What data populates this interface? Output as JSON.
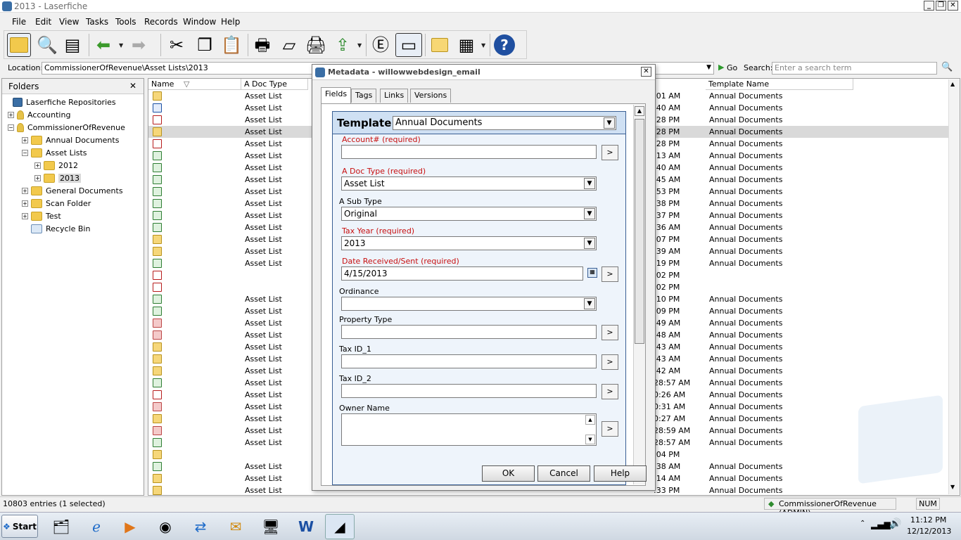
{
  "window": {
    "title": "2013 - Laserfiche",
    "min": "_",
    "restore": "❐",
    "close": "✕"
  },
  "menu": [
    "File",
    "Edit",
    "View",
    "Tasks",
    "Tools",
    "Records",
    "Window",
    "Help"
  ],
  "location": {
    "label": "Location:",
    "value": "CommissionerOfRevenue\\Asset Lists\\2013",
    "go": "Go",
    "search_label": "Search:",
    "search_placeholder": "Enter a search term"
  },
  "folders": {
    "title": "Folders",
    "close": "✕",
    "items": [
      {
        "label": "Laserfiche Repositories",
        "expand": ""
      },
      {
        "label": "Accounting",
        "expand": "+"
      },
      {
        "label": "CommissionerOfRevenue",
        "expand": "−"
      },
      {
        "label": "Annual Documents",
        "expand": "+"
      },
      {
        "label": "Asset Lists",
        "expand": "−"
      },
      {
        "label": "2012",
        "expand": "+"
      },
      {
        "label": "2013",
        "expand": "+"
      },
      {
        "label": "General Documents",
        "expand": "+"
      },
      {
        "label": "Scan Folder",
        "expand": "+"
      },
      {
        "label": "Test",
        "expand": "+"
      },
      {
        "label": "Recycle Bin",
        "expand": ""
      }
    ]
  },
  "list": {
    "columns": {
      "name": "Name",
      "doc_type": "A Doc Type",
      "template": "Template Name"
    },
    "rows": [
      {
        "icon": "mail",
        "doc": "Asset List",
        "time": ":01 AM",
        "tmpl": "Annual Documents"
      },
      {
        "icon": "doc",
        "doc": "Asset List",
        "time": ":40 AM",
        "tmpl": "Annual Documents"
      },
      {
        "icon": "pdf",
        "doc": "Asset List",
        "time": ":28 PM",
        "tmpl": "Annual Documents"
      },
      {
        "icon": "mail",
        "doc": "Asset List",
        "time": ":28 PM",
        "tmpl": "Annual Documents",
        "selected": true
      },
      {
        "icon": "pdf",
        "doc": "Asset List",
        "time": ":28 PM",
        "tmpl": "Annual Documents"
      },
      {
        "icon": "xls",
        "doc": "Asset List",
        "time": ":13 AM",
        "tmpl": "Annual Documents"
      },
      {
        "icon": "xls",
        "doc": "Asset List",
        "time": ":40 AM",
        "tmpl": "Annual Documents"
      },
      {
        "icon": "xls",
        "doc": "Asset List",
        "time": ":45 AM",
        "tmpl": "Annual Documents"
      },
      {
        "icon": "xls",
        "doc": "Asset List",
        "time": ":53 PM",
        "tmpl": "Annual Documents"
      },
      {
        "icon": "xls",
        "doc": "Asset List",
        "time": ":38 PM",
        "tmpl": "Annual Documents"
      },
      {
        "icon": "xls",
        "doc": "Asset List",
        "time": ":37 PM",
        "tmpl": "Annual Documents"
      },
      {
        "icon": "xls",
        "doc": "Asset List",
        "time": ":36 AM",
        "tmpl": "Annual Documents"
      },
      {
        "icon": "mail",
        "doc": "Asset List",
        "time": ":07 PM",
        "tmpl": "Annual Documents"
      },
      {
        "icon": "mail",
        "doc": "Asset List",
        "time": ":39 AM",
        "tmpl": "Annual Documents"
      },
      {
        "icon": "xls",
        "doc": "Asset List",
        "time": ":19 PM",
        "tmpl": "Annual Documents"
      },
      {
        "icon": "pdf",
        "doc": "",
        "time": ":02 PM",
        "tmpl": ""
      },
      {
        "icon": "pdf",
        "doc": "",
        "time": ":02 PM",
        "tmpl": ""
      },
      {
        "icon": "xls",
        "doc": "Asset List",
        "time": ":10 PM",
        "tmpl": "Annual Documents"
      },
      {
        "icon": "xls",
        "doc": "Asset List",
        "time": ":09 PM",
        "tmpl": "Annual Documents"
      },
      {
        "icon": "red",
        "doc": "Asset List",
        "time": ":49 AM",
        "tmpl": "Annual Documents"
      },
      {
        "icon": "red",
        "doc": "Asset List",
        "time": ":48 AM",
        "tmpl": "Annual Documents"
      },
      {
        "icon": "mail",
        "doc": "Asset List",
        "time": ":43 AM",
        "tmpl": "Annual Documents"
      },
      {
        "icon": "mail",
        "doc": "Asset List",
        "time": ":43 AM",
        "tmpl": "Annual Documents"
      },
      {
        "icon": "mail",
        "doc": "Asset List",
        "time": ":42 AM",
        "tmpl": "Annual Documents"
      },
      {
        "icon": "xls",
        "doc": "Asset List",
        "time": "28:57 AM",
        "tmpl": "Annual Documents"
      },
      {
        "icon": "pdf",
        "doc": "Asset List",
        "time": "0:26 AM",
        "tmpl": "Annual Documents"
      },
      {
        "icon": "red",
        "doc": "Asset List",
        "time": "0:31 AM",
        "tmpl": "Annual Documents"
      },
      {
        "icon": "mail",
        "doc": "Asset List",
        "time": "0:27 AM",
        "tmpl": "Annual Documents"
      },
      {
        "icon": "red",
        "doc": "Asset List",
        "time": "28:59 AM",
        "tmpl": "Annual Documents"
      },
      {
        "icon": "xls",
        "doc": "Asset List",
        "time": "28:57 AM",
        "tmpl": "Annual Documents"
      },
      {
        "icon": "mail",
        "doc": "",
        "time": ":04 PM",
        "tmpl": ""
      },
      {
        "icon": "xls",
        "doc": "Asset List",
        "time": ":38 AM",
        "tmpl": "Annual Documents"
      },
      {
        "icon": "mail",
        "doc": "Asset List",
        "time": ":14 AM",
        "tmpl": "Annual Documents"
      },
      {
        "icon": "mail",
        "doc": "Asset List",
        "time": ":33 PM",
        "tmpl": "Annual Documents"
      }
    ]
  },
  "status": {
    "entries": "10803 entries (1 selected)",
    "user": "CommissionerOfRevenue (ADMIN)",
    "num": "NUM"
  },
  "taskbar": {
    "start": "Start",
    "time": "11:12 PM",
    "date": "12/12/2013"
  },
  "dialog": {
    "title": "Metadata - willowwebdesign_email",
    "close": "✕",
    "tabs": [
      "Fields",
      "Tags",
      "Links",
      "Versions"
    ],
    "template_label": "Template:",
    "template_value": "Annual Documents",
    "fields": [
      {
        "label": "Account# (required)",
        "value": ""
      },
      {
        "label": "A Doc Type (required)",
        "value": "Asset List"
      },
      {
        "label": "A Sub Type",
        "value": "Original"
      },
      {
        "label": "Tax Year (required)",
        "value": "2013"
      },
      {
        "label": "Date Received/Sent (required)",
        "value": "4/15/2013"
      },
      {
        "label": "Ordinance",
        "value": ""
      },
      {
        "label": "Property Type",
        "value": ""
      },
      {
        "label": "Tax ID_1",
        "value": ""
      },
      {
        "label": "Tax ID_2",
        "value": ""
      },
      {
        "label": "Owner Name",
        "value": ""
      }
    ],
    "go_symbol": ">",
    "buttons": {
      "ok": "OK",
      "cancel": "Cancel",
      "help": "Help"
    }
  }
}
